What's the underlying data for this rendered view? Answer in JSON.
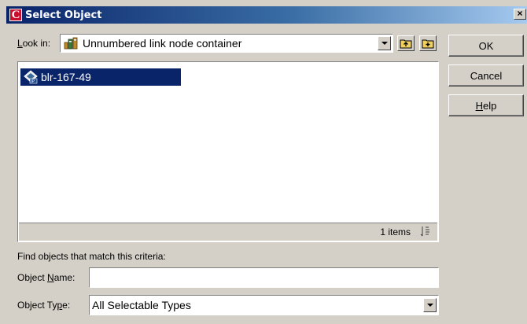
{
  "window": {
    "title": "Select Object",
    "app_icon_letter": "C",
    "close_glyph": "×"
  },
  "look_in": {
    "label_underlined": "L",
    "label_rest": "ook in:",
    "value": "Unnumbered link node container",
    "icon": "network-container-icon"
  },
  "toolbar": {
    "up_icon": "folder-up-icon",
    "new_icon": "folder-new-icon"
  },
  "list": {
    "items": [
      {
        "label": "blr-167-49",
        "icon": "ip-node-icon",
        "selected": true
      }
    ],
    "status": "1 items"
  },
  "buttons": {
    "ok": "OK",
    "cancel": "Cancel",
    "help_underlined": "H",
    "help_rest": "elp"
  },
  "find": {
    "heading": "Find objects that match this criteria:",
    "name_label_pre": "Object ",
    "name_label_underlined": "N",
    "name_label_post": "ame:",
    "name_value": "",
    "type_label_pre": "Object Ty",
    "type_label_underlined": "p",
    "type_label_post": "e:",
    "type_value": "All Selectable Types"
  },
  "colors": {
    "title_start": "#0a246a",
    "title_end": "#a6caf0",
    "selection": "#0a246a",
    "dialog_bg": "#d4d0c8",
    "app_icon": "#c8102e"
  }
}
